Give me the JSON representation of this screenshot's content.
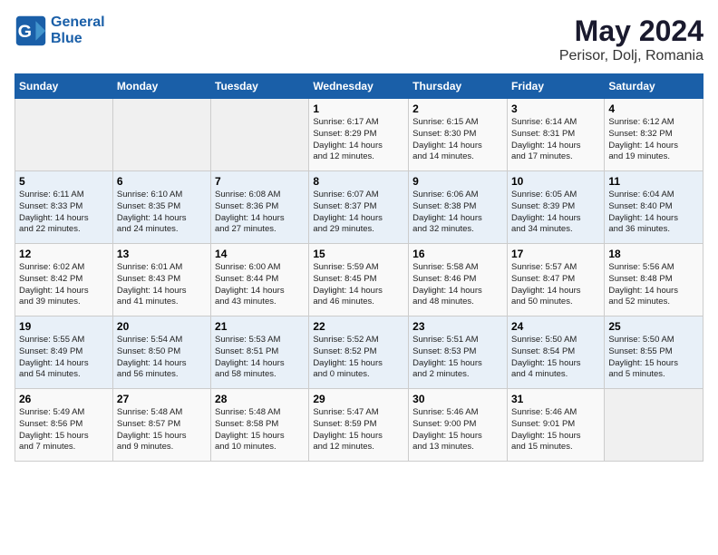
{
  "header": {
    "logo_line1": "General",
    "logo_line2": "Blue",
    "month": "May 2024",
    "location": "Perisor, Dolj, Romania"
  },
  "weekdays": [
    "Sunday",
    "Monday",
    "Tuesday",
    "Wednesday",
    "Thursday",
    "Friday",
    "Saturday"
  ],
  "weeks": [
    [
      {
        "day": "",
        "info": ""
      },
      {
        "day": "",
        "info": ""
      },
      {
        "day": "",
        "info": ""
      },
      {
        "day": "1",
        "info": "Sunrise: 6:17 AM\nSunset: 8:29 PM\nDaylight: 14 hours\nand 12 minutes."
      },
      {
        "day": "2",
        "info": "Sunrise: 6:15 AM\nSunset: 8:30 PM\nDaylight: 14 hours\nand 14 minutes."
      },
      {
        "day": "3",
        "info": "Sunrise: 6:14 AM\nSunset: 8:31 PM\nDaylight: 14 hours\nand 17 minutes."
      },
      {
        "day": "4",
        "info": "Sunrise: 6:12 AM\nSunset: 8:32 PM\nDaylight: 14 hours\nand 19 minutes."
      }
    ],
    [
      {
        "day": "5",
        "info": "Sunrise: 6:11 AM\nSunset: 8:33 PM\nDaylight: 14 hours\nand 22 minutes."
      },
      {
        "day": "6",
        "info": "Sunrise: 6:10 AM\nSunset: 8:35 PM\nDaylight: 14 hours\nand 24 minutes."
      },
      {
        "day": "7",
        "info": "Sunrise: 6:08 AM\nSunset: 8:36 PM\nDaylight: 14 hours\nand 27 minutes."
      },
      {
        "day": "8",
        "info": "Sunrise: 6:07 AM\nSunset: 8:37 PM\nDaylight: 14 hours\nand 29 minutes."
      },
      {
        "day": "9",
        "info": "Sunrise: 6:06 AM\nSunset: 8:38 PM\nDaylight: 14 hours\nand 32 minutes."
      },
      {
        "day": "10",
        "info": "Sunrise: 6:05 AM\nSunset: 8:39 PM\nDaylight: 14 hours\nand 34 minutes."
      },
      {
        "day": "11",
        "info": "Sunrise: 6:04 AM\nSunset: 8:40 PM\nDaylight: 14 hours\nand 36 minutes."
      }
    ],
    [
      {
        "day": "12",
        "info": "Sunrise: 6:02 AM\nSunset: 8:42 PM\nDaylight: 14 hours\nand 39 minutes."
      },
      {
        "day": "13",
        "info": "Sunrise: 6:01 AM\nSunset: 8:43 PM\nDaylight: 14 hours\nand 41 minutes."
      },
      {
        "day": "14",
        "info": "Sunrise: 6:00 AM\nSunset: 8:44 PM\nDaylight: 14 hours\nand 43 minutes."
      },
      {
        "day": "15",
        "info": "Sunrise: 5:59 AM\nSunset: 8:45 PM\nDaylight: 14 hours\nand 46 minutes."
      },
      {
        "day": "16",
        "info": "Sunrise: 5:58 AM\nSunset: 8:46 PM\nDaylight: 14 hours\nand 48 minutes."
      },
      {
        "day": "17",
        "info": "Sunrise: 5:57 AM\nSunset: 8:47 PM\nDaylight: 14 hours\nand 50 minutes."
      },
      {
        "day": "18",
        "info": "Sunrise: 5:56 AM\nSunset: 8:48 PM\nDaylight: 14 hours\nand 52 minutes."
      }
    ],
    [
      {
        "day": "19",
        "info": "Sunrise: 5:55 AM\nSunset: 8:49 PM\nDaylight: 14 hours\nand 54 minutes."
      },
      {
        "day": "20",
        "info": "Sunrise: 5:54 AM\nSunset: 8:50 PM\nDaylight: 14 hours\nand 56 minutes."
      },
      {
        "day": "21",
        "info": "Sunrise: 5:53 AM\nSunset: 8:51 PM\nDaylight: 14 hours\nand 58 minutes."
      },
      {
        "day": "22",
        "info": "Sunrise: 5:52 AM\nSunset: 8:52 PM\nDaylight: 15 hours\nand 0 minutes."
      },
      {
        "day": "23",
        "info": "Sunrise: 5:51 AM\nSunset: 8:53 PM\nDaylight: 15 hours\nand 2 minutes."
      },
      {
        "day": "24",
        "info": "Sunrise: 5:50 AM\nSunset: 8:54 PM\nDaylight: 15 hours\nand 4 minutes."
      },
      {
        "day": "25",
        "info": "Sunrise: 5:50 AM\nSunset: 8:55 PM\nDaylight: 15 hours\nand 5 minutes."
      }
    ],
    [
      {
        "day": "26",
        "info": "Sunrise: 5:49 AM\nSunset: 8:56 PM\nDaylight: 15 hours\nand 7 minutes."
      },
      {
        "day": "27",
        "info": "Sunrise: 5:48 AM\nSunset: 8:57 PM\nDaylight: 15 hours\nand 9 minutes."
      },
      {
        "day": "28",
        "info": "Sunrise: 5:48 AM\nSunset: 8:58 PM\nDaylight: 15 hours\nand 10 minutes."
      },
      {
        "day": "29",
        "info": "Sunrise: 5:47 AM\nSunset: 8:59 PM\nDaylight: 15 hours\nand 12 minutes."
      },
      {
        "day": "30",
        "info": "Sunrise: 5:46 AM\nSunset: 9:00 PM\nDaylight: 15 hours\nand 13 minutes."
      },
      {
        "day": "31",
        "info": "Sunrise: 5:46 AM\nSunset: 9:01 PM\nDaylight: 15 hours\nand 15 minutes."
      },
      {
        "day": "",
        "info": ""
      }
    ]
  ]
}
